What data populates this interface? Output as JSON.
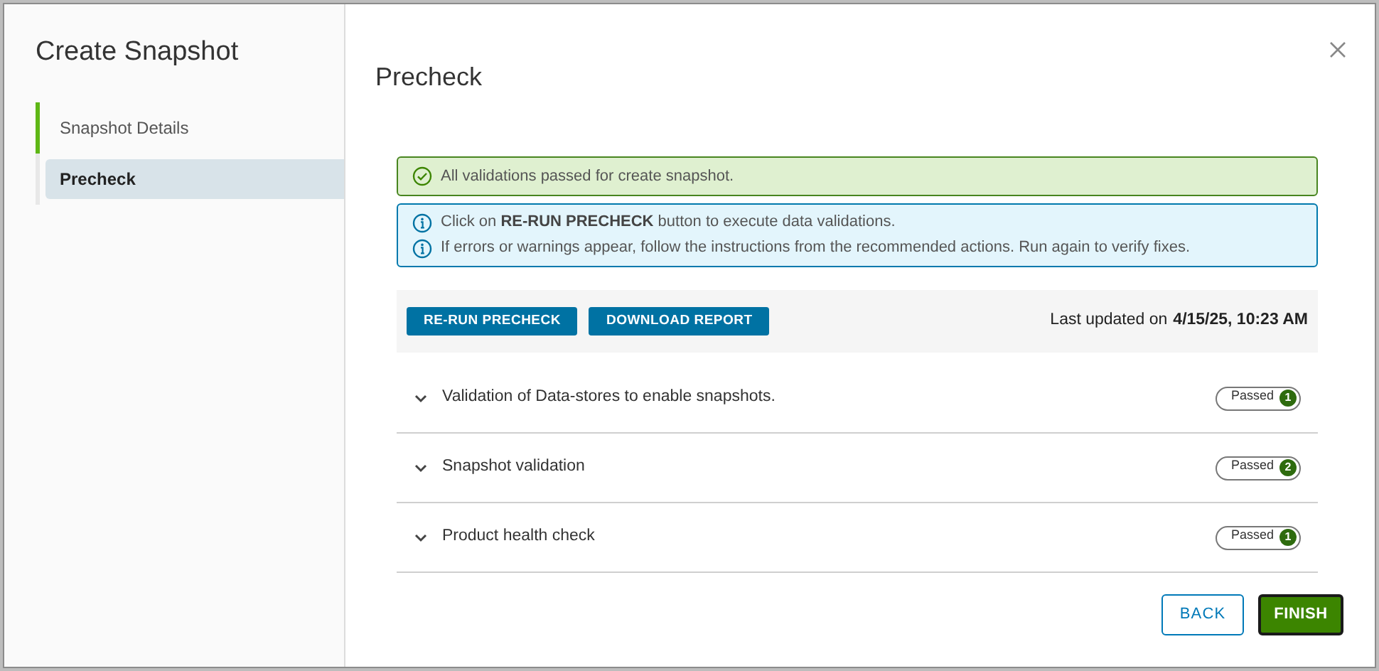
{
  "dialog": {
    "title": "Create Snapshot"
  },
  "steps": [
    {
      "label": "Snapshot Details",
      "selected": false,
      "completed": true
    },
    {
      "label": "Precheck",
      "selected": true,
      "completed": false
    }
  ],
  "page_title": "Precheck",
  "success_alert": {
    "text": "All validations passed for create snapshot."
  },
  "info_alert": {
    "lines": [
      "Click on **RE-RUN PRECHECK** button to execute data validations.",
      "If errors or warnings appear, follow the instructions from the recommended actions. Run again to verify fixes."
    ]
  },
  "toolbar": {
    "buttons": [
      "RE-RUN PRECHECK",
      "DOWNLOAD REPORT"
    ],
    "last_updated_label": "Last updated on",
    "last_updated_value": "4/15/25, 10:23 AM"
  },
  "checks": [
    {
      "title": "Validation of Data-stores to enable snapshots.",
      "status": "Passed",
      "count": "1",
      "expanded": false
    },
    {
      "title": "Snapshot validation",
      "status": "Passed",
      "count": "2",
      "expanded": false
    },
    {
      "title": "Product health check",
      "status": "Passed",
      "count": "1",
      "expanded": false
    }
  ],
  "footer": {
    "back": "BACK",
    "finish": "FINISH"
  }
}
